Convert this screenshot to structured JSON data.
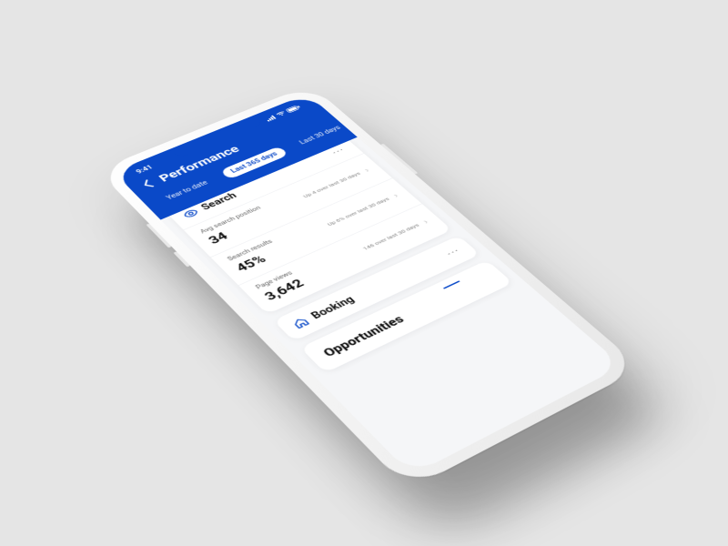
{
  "status": {
    "time": "9:41"
  },
  "page_title": "Performance",
  "tabs": {
    "year": "Year to date",
    "days365": "Last 365 days",
    "days30": "Last 30 days",
    "last": "Las"
  },
  "search": {
    "title": "Search",
    "rows": {
      "position": {
        "label": "Avg search position",
        "value": "34",
        "delta": "Up 4 over last 30 days"
      },
      "results": {
        "label": "Search results",
        "value": "45%",
        "delta": "Up 6% over last 30 days"
      },
      "views": {
        "label": "Page views",
        "value": "3,642",
        "delta": "146 over last 30 days"
      }
    }
  },
  "booking": {
    "title": "Booking"
  },
  "opportunities": {
    "title": "Opportunities"
  }
}
